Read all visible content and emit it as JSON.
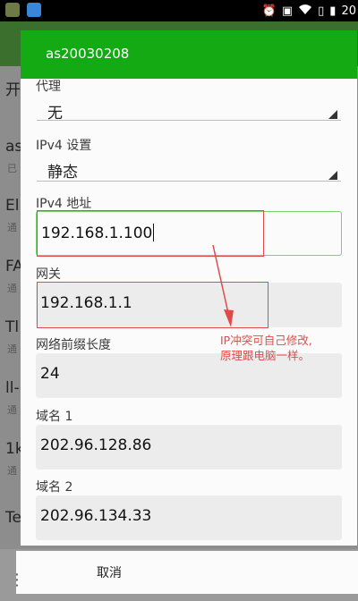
{
  "status_bar": {
    "time": "20",
    "icons": [
      "alarm-icon",
      "notification-icon",
      "wifi-icon",
      "sim-icon",
      "battery-icon"
    ],
    "left_icons": [
      "android-icon",
      "cloud-app-icon"
    ]
  },
  "background_list": {
    "header_letter": "",
    "rows": [
      {
        "title": "开",
        "sub": ""
      },
      {
        "title": "as",
        "sub": "已"
      },
      {
        "title": "El",
        "sub": "通"
      },
      {
        "title": "FA",
        "sub": "通"
      },
      {
        "title": "Tl",
        "sub": "通"
      },
      {
        "title": "ll-",
        "sub": "通"
      },
      {
        "title": "1k",
        "sub": "通"
      },
      {
        "title": "Te",
        "sub": ""
      }
    ]
  },
  "dialog": {
    "title": "as20030208",
    "proxy": {
      "label": "代理",
      "value": "无"
    },
    "ipv4_settings": {
      "label": "IPv4 设置",
      "value": "静态"
    },
    "ipv4_address": {
      "label": "IPv4 地址",
      "value": "192.168.1.100"
    },
    "gateway": {
      "label": "网关",
      "value": "192.168.1.1"
    },
    "prefix_length": {
      "label": "网络前缀长度",
      "value": "24"
    },
    "dns1": {
      "label": "域名 1",
      "value": "202.96.128.86"
    },
    "dns2": {
      "label": "域名 2",
      "value": "202.96.134.33"
    }
  },
  "annotation": {
    "line1": "IP冲突可自己修改,",
    "line2": "原理跟电脑一样。",
    "color": "#e14a4a"
  },
  "buttons": {
    "cancel": "取消"
  },
  "colors": {
    "title_bar": "#14aa14",
    "active_field_border": "#7bd36e"
  }
}
